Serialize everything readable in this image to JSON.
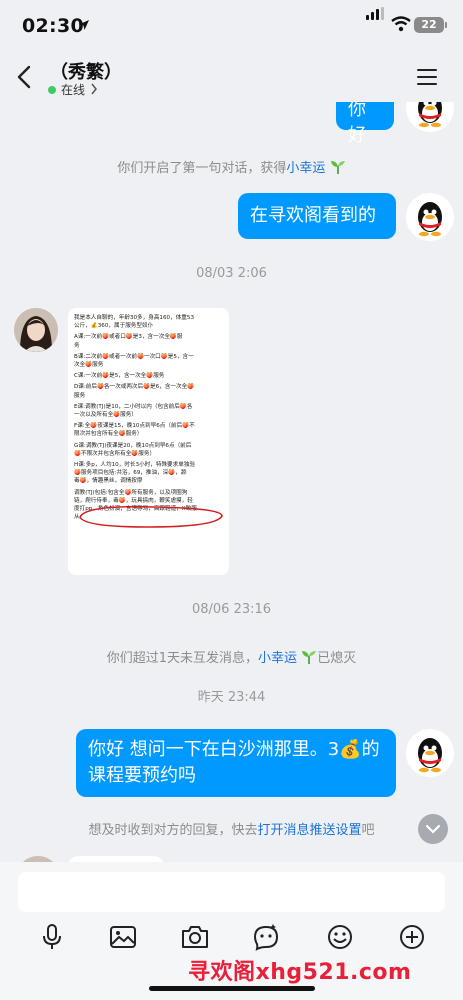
{
  "status_bar": {
    "time": "02:30",
    "battery": "22"
  },
  "header": {
    "title": "（秀繁）",
    "status": "在线"
  },
  "messages": {
    "first_out": "你好",
    "system_first_chat": {
      "prefix": "你们开启了第一句对话，获得",
      "link": "小幸运"
    },
    "second_out": "在寻欢阁看到的",
    "time_1": "08/03 2:06",
    "image_text": {
      "intro1": "我是本人自聊的，年龄30多，身高160，体重53",
      "intro2": "公斤，💰360，属于服务型奴仆",
      "a1": "A课:一次前🍑或者口🍑是3，含一次全🍑服",
      "a2": "务",
      "b1": "B课:二次前🍑或者一次前🍑一次口🍑是5，含一",
      "b2": "次全🍑服务",
      "c1": "C课:一次前🍑是5，含一次全🍑服务",
      "d1": "D课:前后🍑各一次或两次后🍑是6，含一次全🍑",
      "d2": "服务",
      "e1": "E课:调教(TJ)是10，二小时以内（包含前后🍑各",
      "e2": "一次以及所有全🍑服务）",
      "f1": "F课:全🍑夜课是15，晚10点到早6点（前后🍑不",
      "f2": "限次并包含所有全🍑服务）",
      "g1": "G课:调教(TJ)夜课是20，晚10点到早6点（前后",
      "g2": "🍑不限次并包含所有全🍑服务）",
      "h1": "H课:多p，人均10，时长3小时，特殊要求单独验",
      "h2": "🍑服务项目包括:共浴，69，推油，深🍑，舔",
      "h3": "毒🍑，情趣黑丝，调情按摩",
      "i1": "调教(TJ)包括:包含全🍑所有服务，以及项圈狗",
      "i2": "链，爬行侍奉，毒🍑，玩具搞肉，鞭笑虐摸，轻",
      "i3": "度打pp，角色扮演，言语辱骂，高跟鞋道，X致服",
      "i4": "从"
    },
    "time_2": "08/06 23:16",
    "system_no_msg": {
      "prefix": "你们超过1天未互发消息，",
      "link": "小幸运",
      "suffix": "已熄灭"
    },
    "time_3": "昨天 23:44",
    "third_out": "你好 想问一下在白沙洲那里。3💰的课程要预约吗",
    "notice": {
      "prefix": "想及时收到对方的回复，快去",
      "link": "打开消息推送设置",
      "suffix": "吧"
    }
  },
  "composer": {
    "placeholder": ""
  },
  "watermark": "寻欢阁xhg521.com",
  "colors": {
    "accent": "#0099ff",
    "link": "#1a73d9",
    "online": "#3fcb63",
    "watermark": "#e8203a"
  },
  "icons": [
    "location-arrow-icon",
    "signal-icon",
    "wifi-icon",
    "battery-icon",
    "back-chevron-icon",
    "menu-icon",
    "microphone-icon",
    "image-icon",
    "camera-icon",
    "sticker-icon",
    "emoji-icon",
    "plus-icon",
    "chevron-down-icon"
  ]
}
